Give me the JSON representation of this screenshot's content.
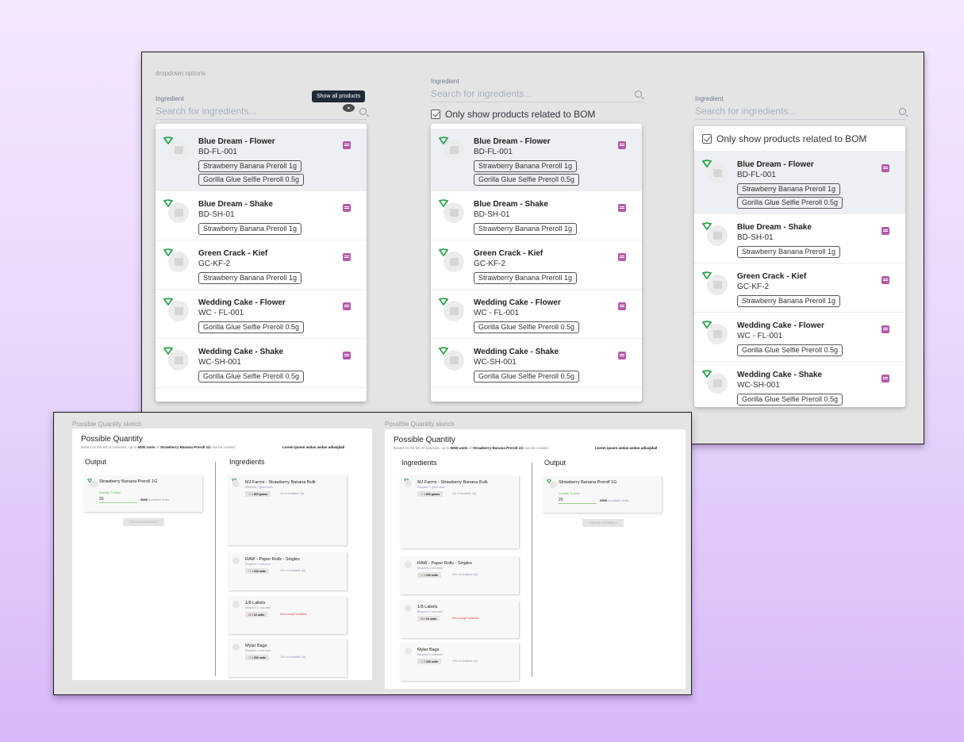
{
  "colors": {
    "background_top": "#f3e8fd",
    "background_bottom": "#d6b9f8",
    "frame_bg": "#e4e4e4",
    "note_icon": "#b35aa8",
    "shield_icon": "#2ea44f",
    "quantity_ok": "#6dbb5a",
    "quantity_error": "#e05050"
  },
  "dropdown_frame": {
    "caption": "dropdown options",
    "tooltip": "Show all products",
    "bom_filter_label": "Only show products related to BOM",
    "field_label": "Ingredient",
    "placeholder": "Search for ingredients...",
    "items": [
      {
        "name": "Blue Dream - Flower",
        "sku": "BD-FL-001",
        "tags": [
          "Strawberry Banana Preroll 1g",
          "Gorilla Glue Selfie Preroll 0.5g"
        ],
        "selected": true
      },
      {
        "name": "Blue Dream - Shake",
        "sku": "BD-SH-01",
        "tags": [
          "Strawberry Banana Preroll 1g"
        ]
      },
      {
        "name": "Green Crack - Kief",
        "sku": "GC-KF-2",
        "tags": [
          "Strawberry Banana Preroll 1g"
        ]
      },
      {
        "name": "Wedding Cake - Flower",
        "sku": "WC - FL-001",
        "tags": [
          "Gorilla Glue Selfie Preroll 0.5g"
        ]
      },
      {
        "name": "Wedding Cake - Shake",
        "sku": "WC-SH-001",
        "tags": [
          "Gorilla Glue Selfie Preroll 0.5g"
        ]
      }
    ]
  },
  "quantity_frame": {
    "caption": "Possible Quantity sketch",
    "title": "Possible Quantity",
    "subtitle_pre": "Based on the bill of materials, up to ",
    "subtitle_units": "5000 units",
    "subtitle_mid": " of ",
    "subtitle_product": "Strawberry Banana Preroll 1G",
    "subtitle_post": " can be created.",
    "lorem": "Lorem ipusm asdas asdan adiasjdail",
    "output_title": "Output",
    "ingredients_title": "Ingredients",
    "output": {
      "name": "Strawberry Banana Preroll 1G",
      "qty_label": "Quantity To Make",
      "qty_value": "20",
      "avail_sep": "/ ",
      "avail_num": "5000",
      "avail_text": " Available Units",
      "button": "CREATE ASSEMBLY"
    },
    "ingredients": [
      {
        "name": "MJ Farms - Strawberry Banana Bulk",
        "req": "Requires 1 gram each",
        "used": "20",
        "total": " / 500 grams",
        "pct": "4% of Available Qty",
        "error": false
      },
      {
        "name": "RAW - Paper Rolls - Singles",
        "req": "Requires 1 unit each",
        "used": "20",
        "total": " / 100 units",
        "pct": "20% of Available Qty",
        "error": false
      },
      {
        "name": "1/8 Labels",
        "req": "Requires 1 unit each",
        "used": "20",
        "total": " / 10 units",
        "pct": "Not enought available",
        "error": true
      },
      {
        "name": "Mylar Bags",
        "req": "Requires 1 unit each",
        "used": "20",
        "total": " / 200 units",
        "pct": "10% of Available Qty",
        "error": false
      }
    ]
  }
}
